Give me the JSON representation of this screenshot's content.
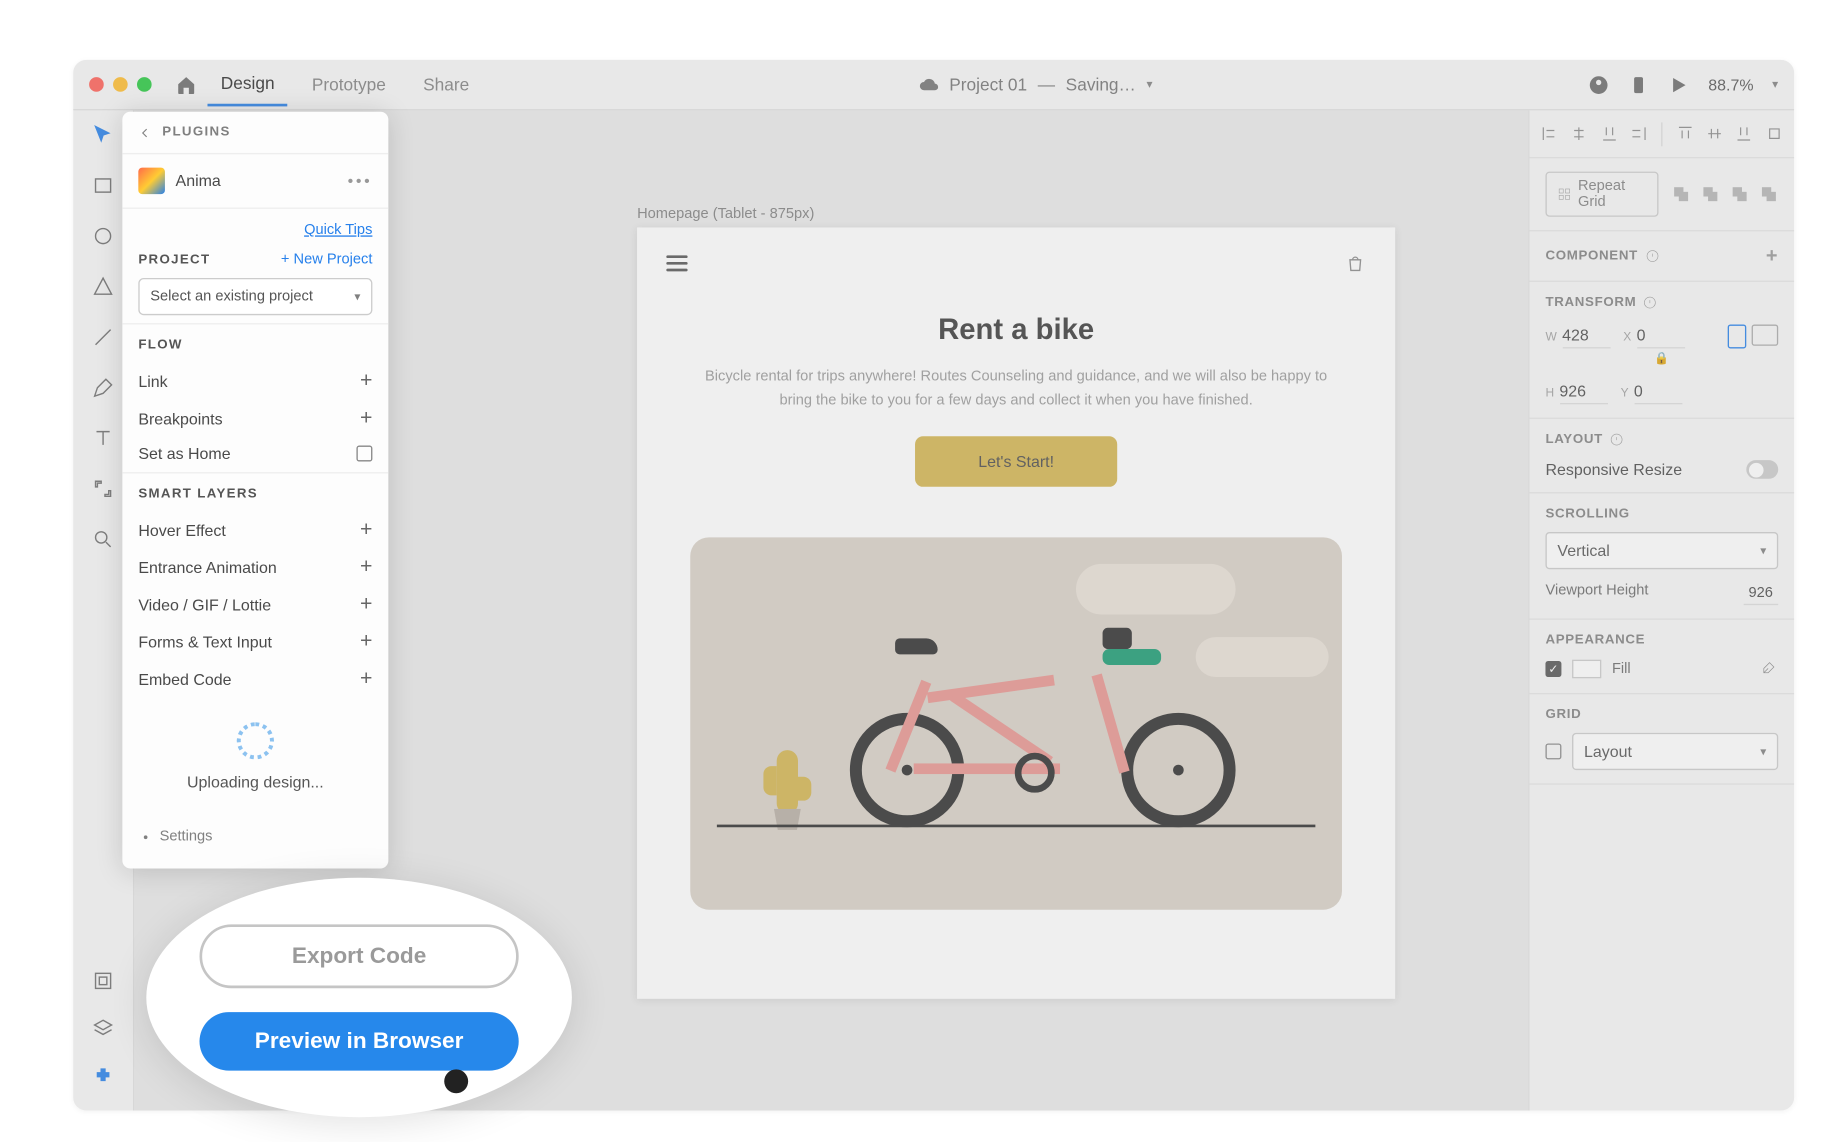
{
  "titlebar": {
    "tabs": {
      "design": "Design",
      "prototype": "Prototype",
      "share": "Share"
    },
    "project": "Project 01",
    "status": "Saving…",
    "zoom": "88.7%"
  },
  "plugin": {
    "header": "PLUGINS",
    "name": "Anima",
    "quick_tips": "Quick Tips",
    "project_label": "PROJECT",
    "new_project": "+ New Project",
    "select_placeholder": "Select an existing project",
    "flow_label": "FLOW",
    "flow_items": {
      "link": "Link",
      "breakpoints": "Breakpoints",
      "set_home": "Set as Home"
    },
    "smart_label": "SMART LAYERS",
    "smart_items": {
      "hover": "Hover Effect",
      "entrance": "Entrance Animation",
      "video": "Video / GIF / Lottie",
      "forms": "Forms & Text Input",
      "embed": "Embed Code"
    },
    "uploading": "Uploading design...",
    "settings": "Settings"
  },
  "callout": {
    "export": "Export Code",
    "preview": "Preview in Browser"
  },
  "artboard": {
    "label": "Homepage (Tablet - 875px)",
    "title": "Rent a bike",
    "subtitle": "Bicycle rental for trips anywhere! Routes Counseling and guidance, and we will also be happy to bring the bike to you for a few days and collect it when you have finished.",
    "cta": "Let's Start!"
  },
  "right_panel": {
    "repeat_grid": "Repeat Grid",
    "component": "COMPONENT",
    "transform": "TRANSFORM",
    "w": "428",
    "h": "926",
    "x": "0",
    "y": "0",
    "layout": "LAYOUT",
    "responsive": "Responsive Resize",
    "scrolling": "SCROLLING",
    "scroll_mode": "Vertical",
    "viewport_label": "Viewport Height",
    "viewport_val": "926",
    "appearance": "APPEARANCE",
    "fill": "Fill",
    "grid": "GRID",
    "grid_mode": "Layout"
  }
}
